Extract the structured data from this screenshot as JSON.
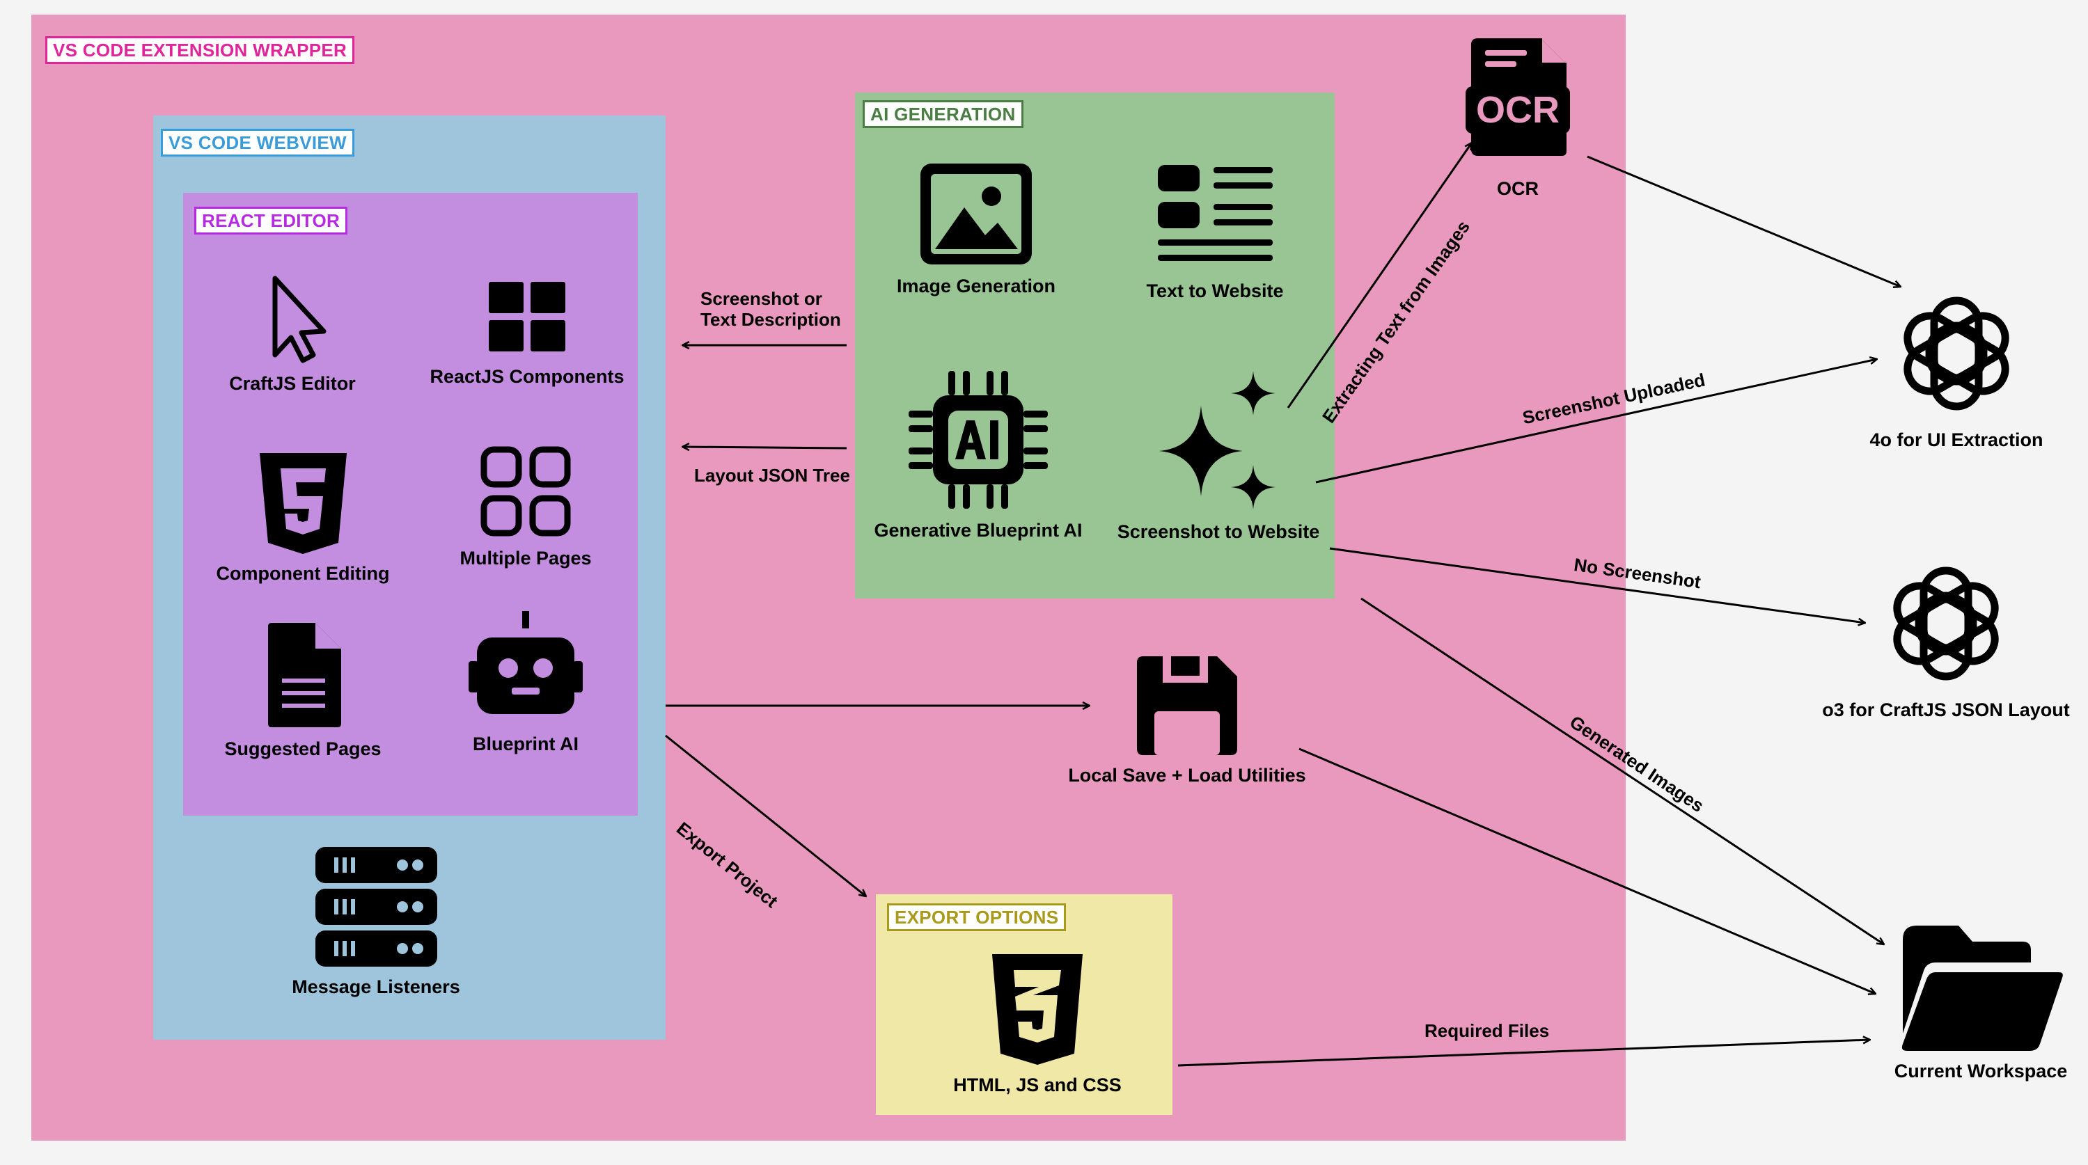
{
  "colors": {
    "wrapper": "#e899bd",
    "webview": "#9fc5dc",
    "react": "#c48ee0",
    "ai": "#99c493",
    "export": "#f0e8a6",
    "wrapper_tag": "#e0259a",
    "webview_tag": "#3a9bd9",
    "react_tag": "#b62be0",
    "ai_tag": "#4a7d42",
    "export_tag": "#a99a1a"
  },
  "regions": {
    "wrapper": "VS CODE EXTENSION WRAPPER",
    "webview": "VS CODE WEBVIEW",
    "react": "REACT EDITOR",
    "ai": "AI GENERATION",
    "export": "EXPORT OPTIONS"
  },
  "nodes": {
    "craftjs_editor": {
      "label": "CraftJS Editor",
      "icon": "cursor-icon"
    },
    "reactjs_components": {
      "label": "ReactJS Components",
      "icon": "grid-icon"
    },
    "component_editing": {
      "label": "Component Editing",
      "icon": "html5-icon"
    },
    "multiple_pages": {
      "label": "Multiple Pages",
      "icon": "pages-grid-icon"
    },
    "suggested_pages": {
      "label": "Suggested Pages",
      "icon": "document-icon"
    },
    "blueprint_ai": {
      "label": "Blueprint AI",
      "icon": "robot-icon"
    },
    "message_listeners": {
      "label": "Message Listeners",
      "icon": "server-icon"
    },
    "image_generation": {
      "label": "Image Generation",
      "icon": "image-icon"
    },
    "text_to_website": {
      "label": "Text to Website",
      "icon": "text-layout-icon"
    },
    "generative_blueprint_ai": {
      "label": "Generative Blueprint AI",
      "icon": "ai-chip-icon"
    },
    "screenshot_to_website": {
      "label": "Screenshot to Website",
      "icon": "sparkles-icon"
    },
    "local_save": {
      "label": "Local Save + Load Utilities",
      "icon": "floppy-icon"
    },
    "html_js_css": {
      "label": "HTML, JS and CSS",
      "icon": "css3-icon"
    },
    "ocr": {
      "label": "OCR",
      "icon": "ocr-icon"
    },
    "gpt4o": {
      "label": "4o for UI Extraction",
      "icon": "openai-icon"
    },
    "o3": {
      "label": "o3 for CraftJS JSON Layout",
      "icon": "openai-icon"
    },
    "workspace": {
      "label": "Current Workspace",
      "icon": "folder-icon"
    }
  },
  "edges": {
    "screenshot_or_text": "Screenshot or\nText Description",
    "layout_json": "Layout JSON Tree",
    "export_project": "Export Project",
    "extracting_text": "Extracting Text from Images",
    "screenshot_uploaded": "Screenshot Uploaded",
    "no_screenshot": "No Screenshot",
    "generated_images": "Generated Images",
    "required_files": "Required Files"
  }
}
